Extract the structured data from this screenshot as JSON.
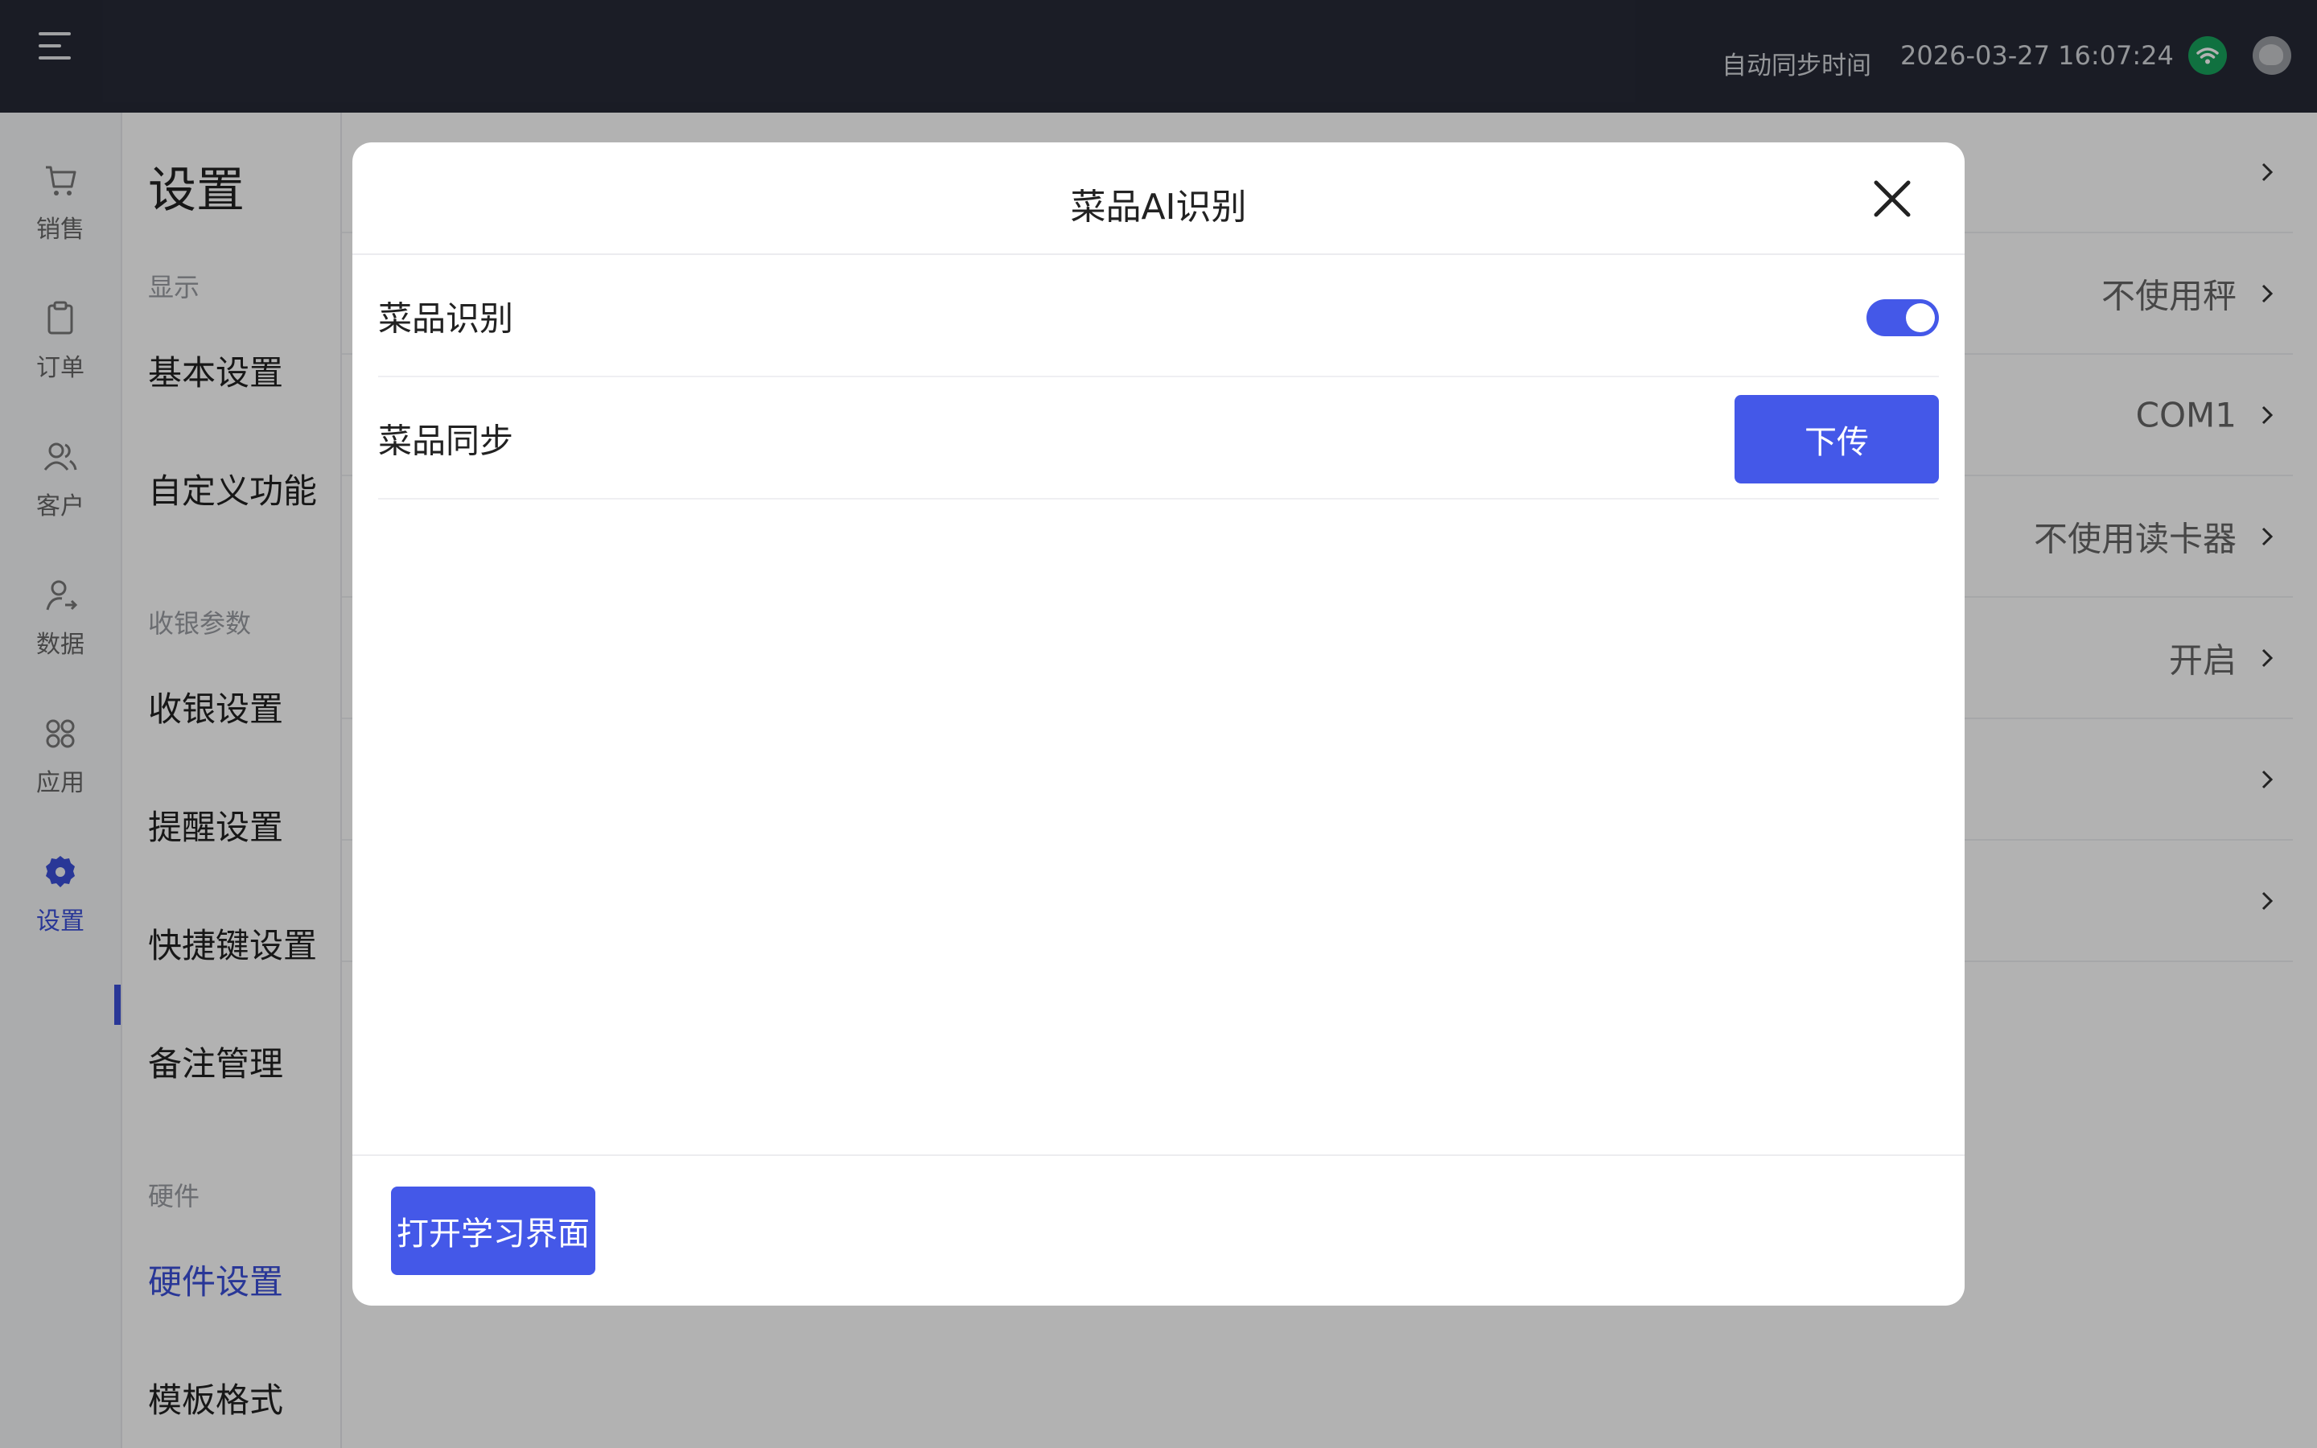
{
  "topbar": {
    "sync_label": "自动同步时间",
    "sync_time": "2026-03-27 16:07:24"
  },
  "nav": {
    "items": [
      {
        "label": "销售",
        "icon": "cart-icon"
      },
      {
        "label": "订单",
        "icon": "clipboard-icon"
      },
      {
        "label": "客户",
        "icon": "users-icon"
      },
      {
        "label": "数据",
        "icon": "user-data-icon"
      },
      {
        "label": "应用",
        "icon": "apps-icon"
      },
      {
        "label": "设置",
        "icon": "gear-icon",
        "active": true
      }
    ]
  },
  "settings": {
    "title": "设置",
    "sections": [
      {
        "label": "显示",
        "items": [
          "基本设置",
          "自定义功能"
        ]
      },
      {
        "label": "收银参数",
        "items": [
          "收银设置",
          "提醒设置",
          "快捷键设置",
          "备注管理"
        ]
      },
      {
        "label": "硬件",
        "items": [
          "硬件设置",
          "模板格式"
        ]
      }
    ],
    "active_item": "硬件设置"
  },
  "content": {
    "rows": [
      {
        "value": ""
      },
      {
        "value": "不使用秤"
      },
      {
        "value": "COM1"
      },
      {
        "value": "不使用读卡器"
      },
      {
        "value": "开启"
      },
      {
        "value": ""
      },
      {
        "value": ""
      }
    ]
  },
  "modal": {
    "title": "菜品AI识别",
    "recognition_label": "菜品识别",
    "recognition_enabled": true,
    "sync_label": "菜品同步",
    "upload_button": "下传",
    "learn_button": "打开学习界面"
  },
  "colors": {
    "topbar": "#262936",
    "accent": "#4458e8",
    "active_text": "#3b4fd8",
    "wifi": "#18a35c"
  }
}
